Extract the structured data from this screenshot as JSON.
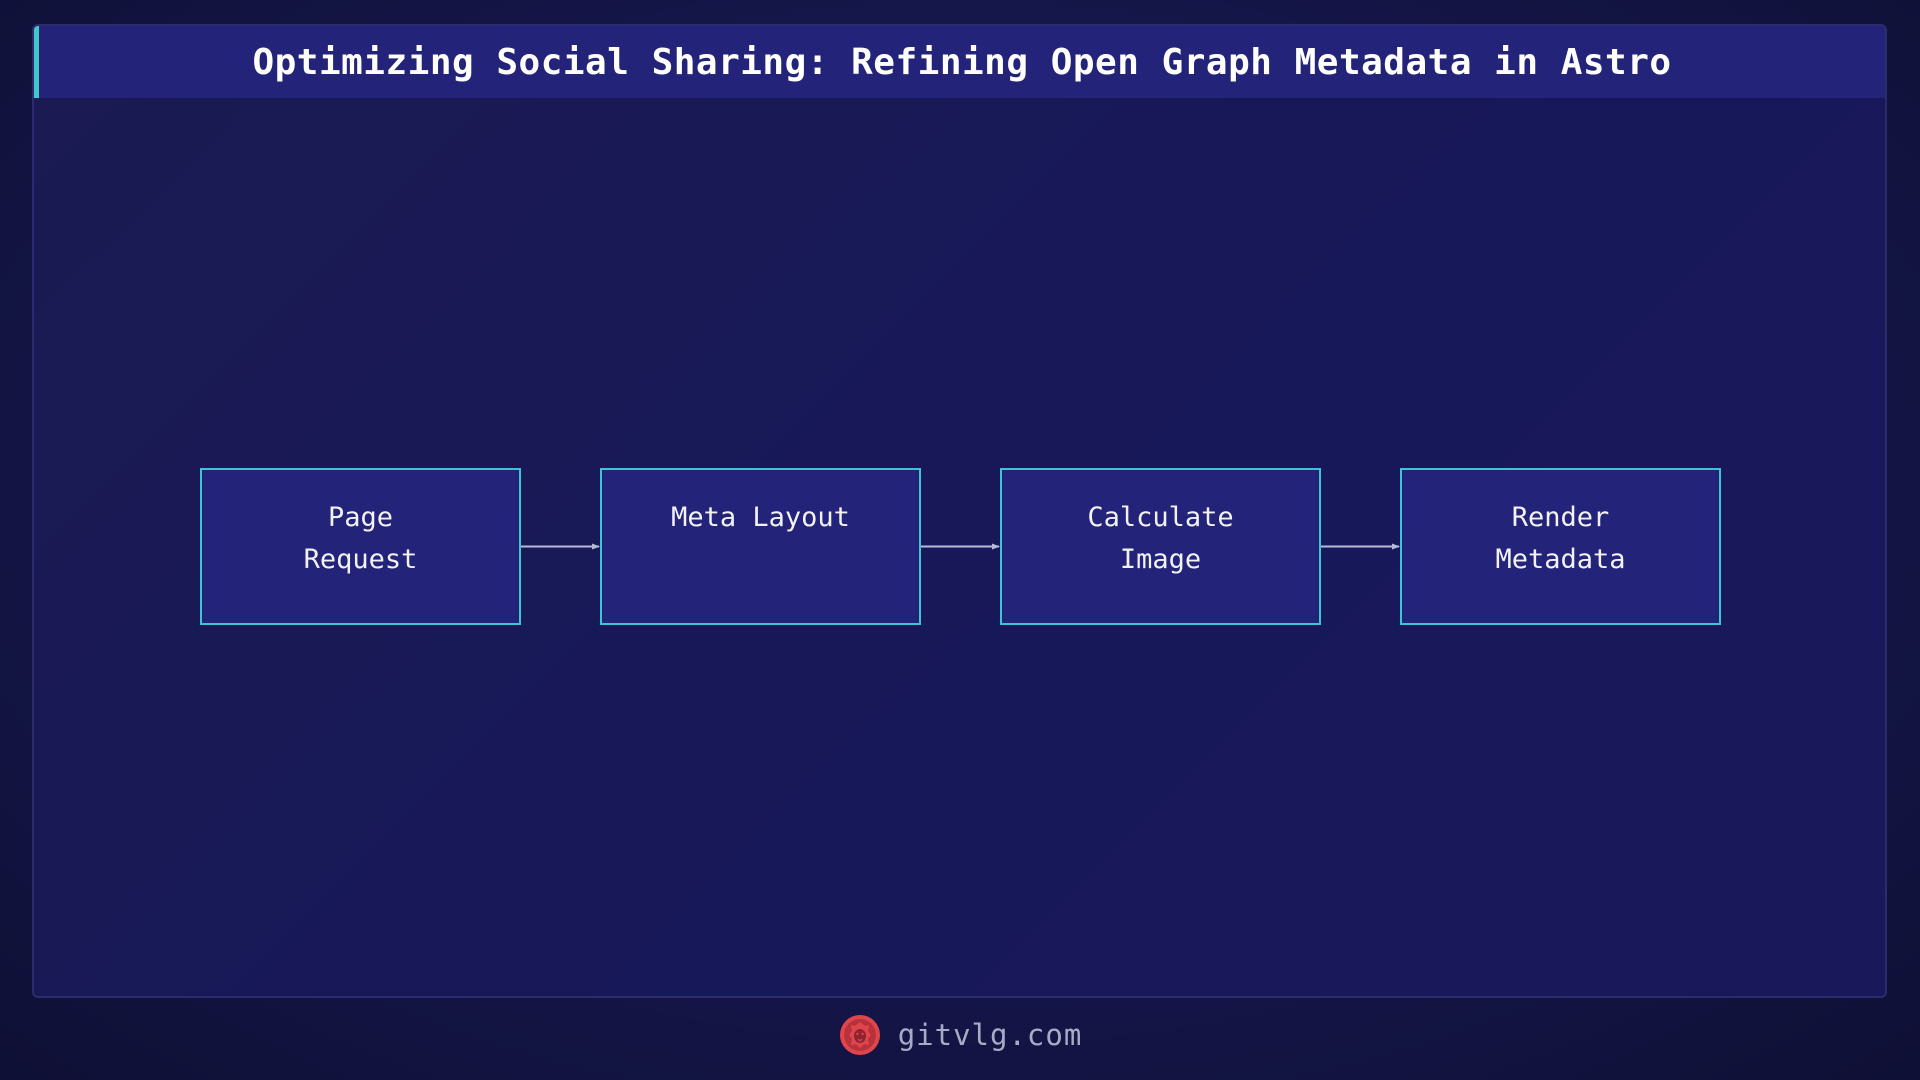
{
  "title": "Optimizing Social Sharing: Refining Open Graph Metadata in Astro",
  "colors": {
    "accent": "#3fc9c9",
    "node_fill": "#23237a",
    "node_border": "#3fc4d6",
    "arrow": "#b8bbd6",
    "logo": "#e0454c"
  },
  "diagram": {
    "nodes": [
      {
        "id": "page-request",
        "label": "Page\nRequest"
      },
      {
        "id": "meta-layout",
        "label": "Meta Layout"
      },
      {
        "id": "calculate-image",
        "label": "Calculate\nImage"
      },
      {
        "id": "render-metadata",
        "label": "Render\nMetadata"
      }
    ],
    "edges": [
      {
        "from": "page-request",
        "to": "meta-layout"
      },
      {
        "from": "meta-layout",
        "to": "calculate-image"
      },
      {
        "from": "calculate-image",
        "to": "render-metadata"
      }
    ]
  },
  "footer": {
    "logo_icon": "lion-head-icon",
    "site": "gitvlg.com"
  }
}
